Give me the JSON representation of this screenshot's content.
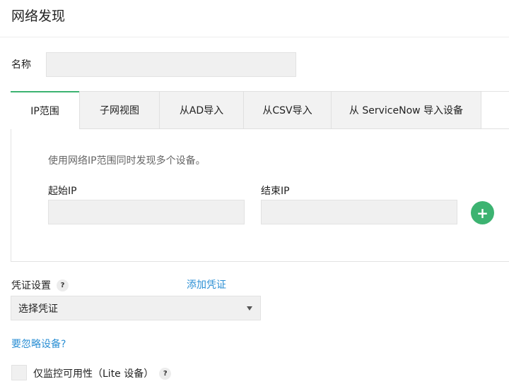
{
  "page": {
    "title": "网络发现"
  },
  "name_field": {
    "label": "名称",
    "value": "",
    "placeholder": ""
  },
  "tabs": [
    {
      "label": "IP范围",
      "active": true
    },
    {
      "label": "子网视图",
      "active": false
    },
    {
      "label": "从AD导入",
      "active": false
    },
    {
      "label": "从CSV导入",
      "active": false
    },
    {
      "label": "从 ServiceNow 导入设备",
      "active": false
    }
  ],
  "ip_range": {
    "description": "使用网络IP范围同时发现多个设备。",
    "start_label": "起始IP",
    "start_value": "",
    "end_label": "结束IP",
    "end_value": "",
    "add_button": "+"
  },
  "credentials": {
    "label": "凭证设置",
    "help": "?",
    "add_link": "添加凭证",
    "select_value": "选择凭证"
  },
  "ignore_link": "要忽略设备?",
  "lite": {
    "label": "仅监控可用性（Lite 设备）",
    "help": "?",
    "checked": false
  },
  "colors": {
    "accent_green": "#3cb371",
    "link_blue": "#2b8fd4"
  },
  "icons": {
    "add": "plus-circle-icon",
    "dropdown": "caret-down-icon",
    "help": "question-icon"
  }
}
